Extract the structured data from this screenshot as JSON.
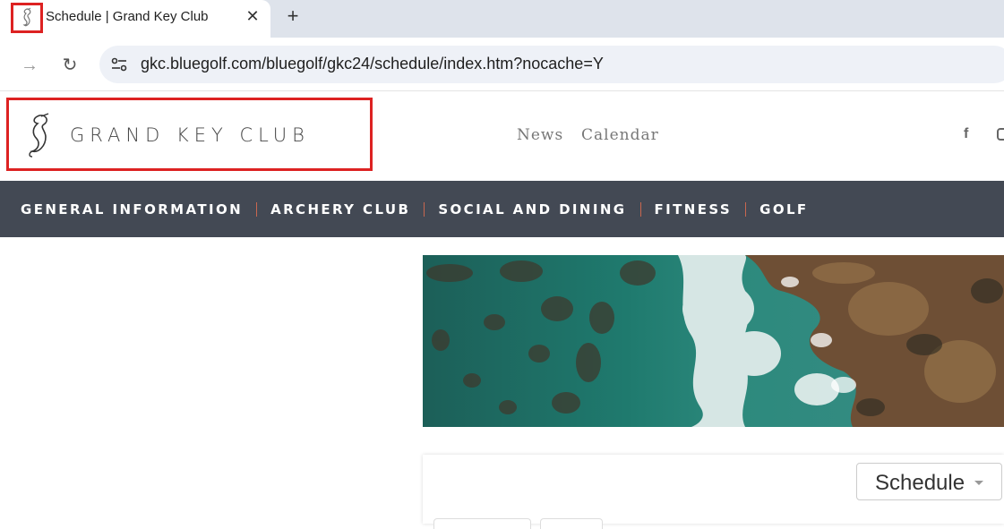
{
  "browser": {
    "tab_title": "Schedule | Grand Key Club",
    "close_glyph": "✕",
    "new_tab_glyph": "+",
    "url": "gkc.bluegolf.com/bluegolf/gkc24/schedule/index.htm?nocache=Y",
    "back_glyph": "→",
    "reload_glyph": "↻"
  },
  "header": {
    "logo_text": "GRAND KEY CLUB",
    "links": [
      "News",
      "Calendar"
    ],
    "social": {
      "facebook": "f"
    }
  },
  "main_nav": {
    "items": [
      "GENERAL INFORMATION",
      "ARCHERY CLUB",
      "SOCIAL AND DINING",
      "FITNESS",
      "GOLF"
    ]
  },
  "content": {
    "schedule_select": "Schedule"
  },
  "colors": {
    "nav_bg": "#434954",
    "nav_separator": "#c9674f",
    "highlight_box": "#dd2222"
  }
}
